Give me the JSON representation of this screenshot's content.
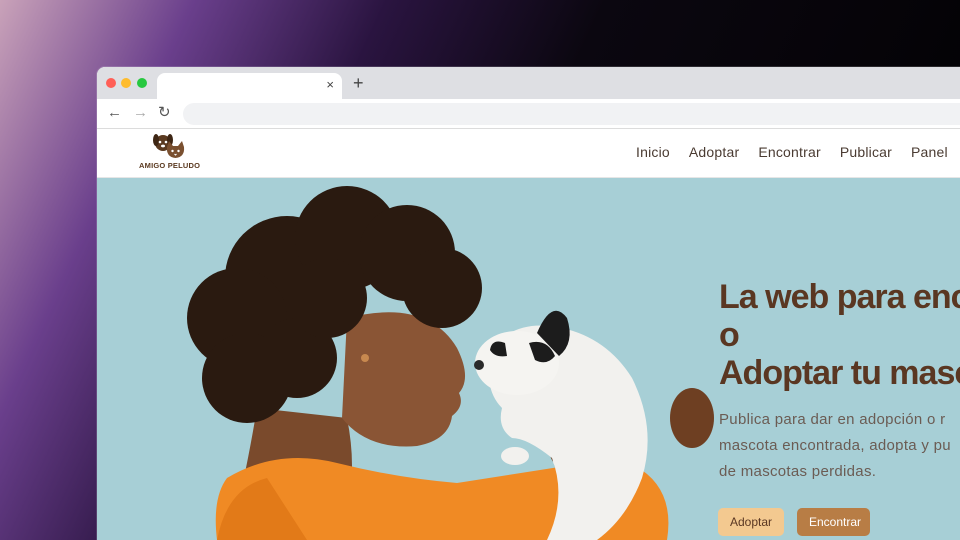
{
  "browser": {
    "tab_close_icon": "close-icon",
    "new_tab_icon": "plus-icon",
    "back_icon": "arrow-left-icon",
    "forward_icon": "arrow-right-icon",
    "reload_icon": "reload-icon",
    "glyphs": {
      "close": "×",
      "plus": "+",
      "back": "←",
      "forward": "→",
      "reload": "↻"
    }
  },
  "site": {
    "logo_text": "AMIGO PELUDO",
    "nav": [
      "Inicio",
      "Adoptar",
      "Encontrar",
      "Publicar",
      "Panel"
    ]
  },
  "hero": {
    "headline_lines": [
      "La web para enc",
      "o",
      "Adoptar tu masc"
    ],
    "subtitle_lines": [
      "Publica para dar en adopción o r",
      "mascota encontrada, adopta y pu",
      "de mascotas perdidas."
    ],
    "adopt_button": "Adoptar",
    "find_button": "Encontrar"
  },
  "colors": {
    "hero_bg": "#a7cfd6",
    "headline": "#5a3722",
    "adopt_button_bg": "#f3c990",
    "find_button_bg": "#b87d45"
  }
}
